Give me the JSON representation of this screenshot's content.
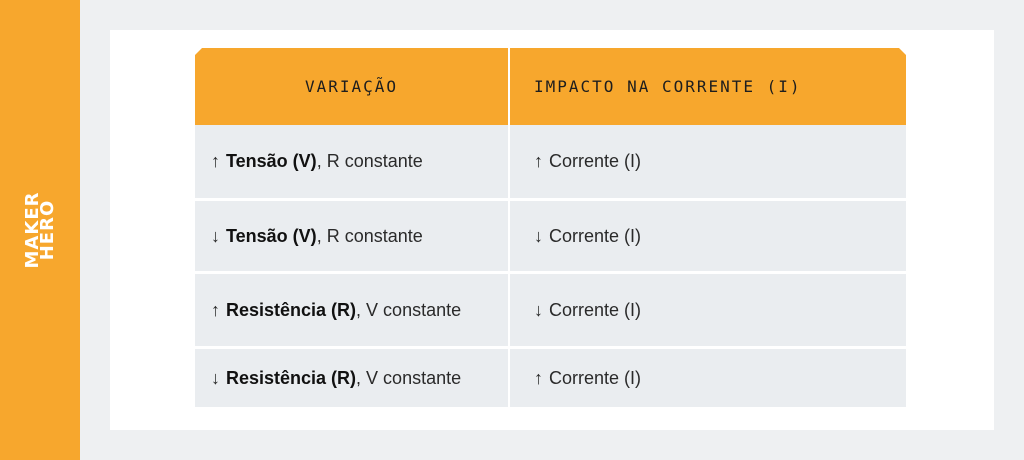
{
  "brand": {
    "logo_line1": "MAKER",
    "logo_line2": "HERO",
    "accent_color": "#f7a72d"
  },
  "table": {
    "headers": [
      "VARIAÇÃO",
      "IMPACTO NA CORRENTE (I)"
    ],
    "rows": [
      {
        "arrow": "↑",
        "variable": "Tensão (V)",
        "condition": ", R constante",
        "impact_arrow": "↑",
        "impact": "Corrente (I)"
      },
      {
        "arrow": "↓",
        "variable": "Tensão (V)",
        "condition": ", R constante",
        "impact_arrow": "↓",
        "impact": "Corrente (I)"
      },
      {
        "arrow": "↑",
        "variable": "Resistência (R)",
        "condition": ", V constante",
        "impact_arrow": "↓",
        "impact": "Corrente (I)"
      },
      {
        "arrow": "↓",
        "variable": "Resistência (R)",
        "condition": ", V constante",
        "impact_arrow": "↑",
        "impact": "Corrente (I)"
      }
    ]
  }
}
